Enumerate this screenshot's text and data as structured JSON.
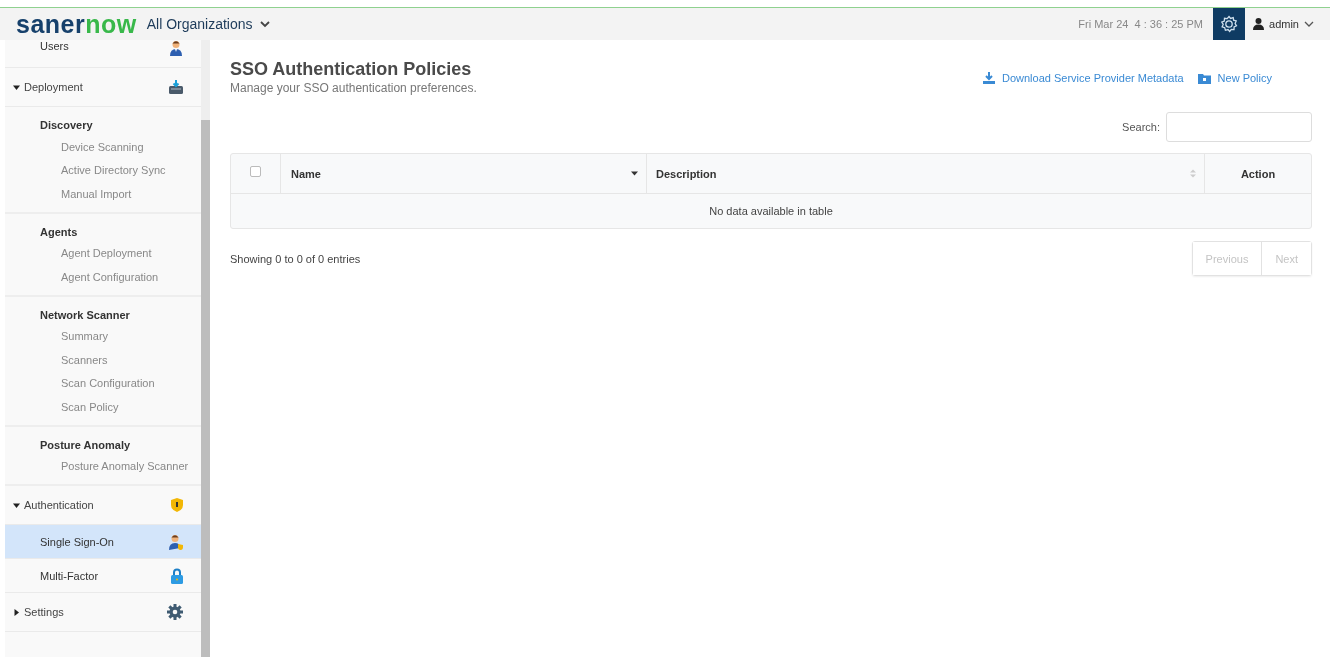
{
  "header": {
    "logo": {
      "primary": "saner",
      "accent": "now"
    },
    "org_selector": "All Organizations",
    "clock": "Fri Mar 24  4 : 36 : 25 PM",
    "user": "admin"
  },
  "sidebar": {
    "items": [
      {
        "kind": "item",
        "label": "Users",
        "selected": false
      },
      {
        "kind": "section",
        "label": "Deployment",
        "expanded": true
      },
      {
        "kind": "group",
        "label": "Discovery",
        "children": [
          {
            "label": "Device Scanning"
          },
          {
            "label": "Active Directory Sync"
          },
          {
            "label": "Manual Import"
          }
        ]
      },
      {
        "kind": "group",
        "label": "Agents",
        "children": [
          {
            "label": "Agent Deployment"
          },
          {
            "label": "Agent Configuration"
          }
        ]
      },
      {
        "kind": "group",
        "label": "Network Scanner",
        "children": [
          {
            "label": "Summary"
          },
          {
            "label": "Scanners"
          },
          {
            "label": "Scan Configuration"
          },
          {
            "label": "Scan Policy"
          }
        ]
      },
      {
        "kind": "group",
        "label": "Posture Anomaly",
        "children": [
          {
            "label": "Posture Anomaly Scanner"
          }
        ]
      },
      {
        "kind": "section",
        "label": "Authentication",
        "expanded": true
      },
      {
        "kind": "item",
        "label": "Single Sign-On",
        "selected": true
      },
      {
        "kind": "item",
        "label": "Multi-Factor",
        "selected": false
      },
      {
        "kind": "section",
        "label": "Settings",
        "expanded": false
      }
    ]
  },
  "page": {
    "title": "SSO Authentication Policies",
    "subtitle": "Manage your SSO authentication preferences.",
    "actions": [
      {
        "kind": "download",
        "label": "Download Service Provider Metadata"
      },
      {
        "kind": "folder",
        "label": "New Policy"
      }
    ],
    "search": {
      "label": "Search:"
    },
    "table": {
      "columns": [
        {
          "kind": "checkbox",
          "checked": false
        },
        {
          "kind": "text",
          "label": "Name",
          "sorted": true
        },
        {
          "kind": "text",
          "label": "Description",
          "sorted": false
        },
        {
          "kind": "plain",
          "label": "Action"
        }
      ],
      "empty_message": "No data available in table"
    },
    "info": "Showing 0 to 0 of 0 entries",
    "pagination": [
      {
        "label": "Previous",
        "disabled": true
      },
      {
        "label": "Next",
        "disabled": true
      }
    ]
  }
}
